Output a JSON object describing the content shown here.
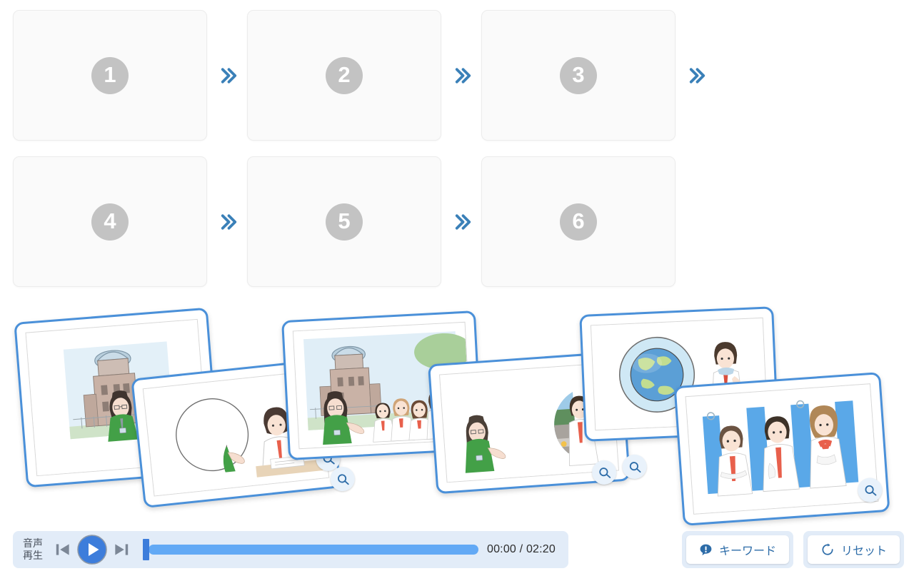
{
  "sequence": {
    "slots": [
      {
        "number": "1",
        "name": "sequence-slot-1",
        "connector_after": true
      },
      {
        "number": "2",
        "name": "sequence-slot-2",
        "connector_after": true
      },
      {
        "number": "3",
        "name": "sequence-slot-3",
        "connector_after": true
      },
      {
        "number": "4",
        "name": "sequence-slot-4",
        "connector_after": true
      },
      {
        "number": "5",
        "name": "sequence-slot-5",
        "connector_after": true
      },
      {
        "number": "6",
        "name": "sequence-slot-6",
        "connector_after": false
      }
    ],
    "connector_icon": "double-chevron-right-icon",
    "connector_color": "#3a80b8",
    "slot_bg": "#fafafa",
    "slot_number_bg": "#c3c3c3"
  },
  "deck": {
    "zoom_badge_icon": "magnifier-icon",
    "card_border_color": "#4a90d9",
    "cards": [
      {
        "id": "card-dome-guide",
        "alt": "guide standing in front of the A-Bomb Dome"
      },
      {
        "id": "card-guide-portrait",
        "alt": "circular portrait of the guide talking with a student taking notes"
      },
      {
        "id": "card-dome-group",
        "alt": "guide explaining to a group of students at the A-Bomb Dome"
      },
      {
        "id": "card-cenotaph",
        "alt": "guide and student at the memorial cenotaph arch with flowers"
      },
      {
        "id": "card-globe",
        "alt": "globe of the Earth with a student thinking"
      },
      {
        "id": "card-bus",
        "alt": "three students standing in a bus holding straps"
      }
    ]
  },
  "player": {
    "label_line1": "音声",
    "label_line2": "再生",
    "prev_icon": "skip-previous-icon",
    "play_icon": "play-icon",
    "next_icon": "skip-next-icon",
    "current_time": "00:00",
    "duration": "02:20",
    "time_display": "00:00 / 02:20",
    "progress_percent": 0,
    "track_color": "#62a9f5",
    "thumb_color": "#3d7ddb"
  },
  "actions": {
    "keyword": {
      "label": "キーワード",
      "icon": "exclamation-speech-bubble-icon"
    },
    "reset": {
      "label": "リセット",
      "icon": "refresh-circular-arrow-icon"
    }
  }
}
